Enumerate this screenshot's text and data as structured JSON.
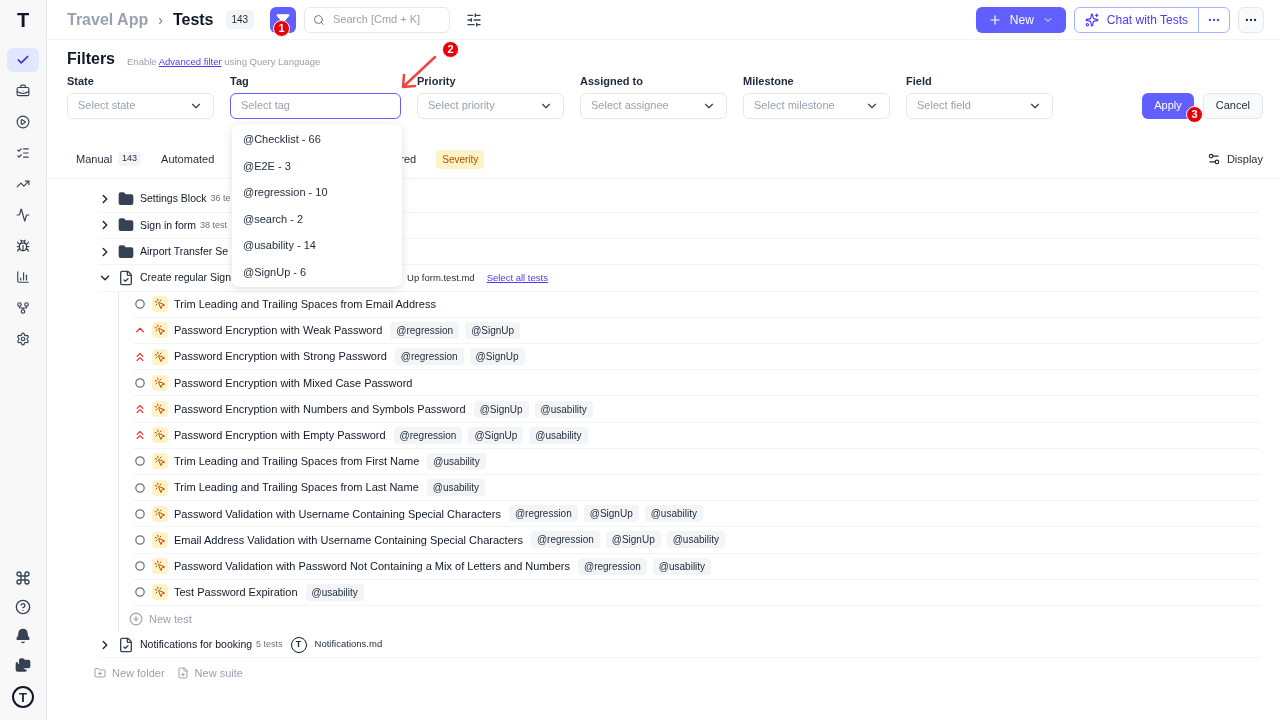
{
  "sidebar": {
    "logo": "T",
    "nav_items": [
      {
        "selected": true
      },
      {
        "selected": false
      },
      {
        "selected": false
      },
      {
        "selected": false
      },
      {
        "selected": false
      },
      {
        "selected": false
      },
      {
        "selected": false
      },
      {
        "selected": false
      },
      {
        "selected": false
      },
      {
        "selected": false
      }
    ],
    "avatar": "T"
  },
  "header": {
    "project": "Travel App",
    "separator": "›",
    "title": "Tests",
    "count": "143",
    "search_placeholder": "Search [Cmd + K]",
    "new_button": "New",
    "chat_button": "Chat with Tests"
  },
  "filters": {
    "title": "Filters",
    "hint_prefix": "Enable",
    "hint_link": "Advanced filter",
    "hint_suffix": "using Query Language",
    "fields": [
      {
        "label": "State",
        "placeholder": "Select state",
        "focused": false
      },
      {
        "label": "Tag",
        "placeholder": "Select tag",
        "focused": true
      },
      {
        "label": "Priority",
        "placeholder": "Select priority",
        "focused": false
      },
      {
        "label": "Assigned to",
        "placeholder": "Select assignee",
        "focused": false
      },
      {
        "label": "Milestone",
        "placeholder": "Select milestone",
        "focused": false
      },
      {
        "label": "Field",
        "placeholder": "Select field",
        "focused": false
      }
    ],
    "apply": "Apply",
    "cancel": "Cancel"
  },
  "tag_dropdown": {
    "options": [
      "@Checklist - 66",
      "@E2E - 3",
      "@regression - 10",
      "@search - 2",
      "@usability - 14",
      "@SignUp - 6"
    ]
  },
  "tabs": [
    {
      "label": "Manual",
      "count": "143"
    },
    {
      "label": "Automated"
    }
  ],
  "tab_fragment": "red",
  "severity": "Severity",
  "display": "Display",
  "tree": [
    {
      "kind": "folder",
      "name": "Settings Block",
      "count": "36 te",
      "expanded": false
    },
    {
      "kind": "folder",
      "name": "Sign in form",
      "count": "38 test",
      "expanded": false
    },
    {
      "kind": "folder",
      "name": "Airport Transfer Se",
      "expanded": false
    },
    {
      "kind": "suite",
      "name": "Create regular Sign",
      "file": "Up form.test.md",
      "link": "Select all tests",
      "expanded": true,
      "tests": [
        {
          "kind": "normal",
          "name": "Trim Leading and Trailing Spaces from Email Address"
        },
        {
          "kind": "high",
          "name": "Password Encryption with Weak Password",
          "tags": [
            "@regression",
            "@SignUp"
          ]
        },
        {
          "kind": "critical",
          "name": "Password Encryption with Strong Password",
          "tags": [
            "@regression",
            "@SignUp"
          ]
        },
        {
          "kind": "normal",
          "name": "Password Encryption with Mixed Case Password"
        },
        {
          "kind": "critical",
          "name": "Password Encryption with Numbers and Symbols Password",
          "tags": [
            "@SignUp",
            "@usability"
          ]
        },
        {
          "kind": "critical",
          "name": "Password Encryption with Empty Password",
          "tags": [
            "@regression",
            "@SignUp",
            "@usability"
          ]
        },
        {
          "kind": "normal",
          "name": "Trim Leading and Trailing Spaces from First Name",
          "tags": [
            "@usability"
          ]
        },
        {
          "kind": "normal",
          "name": "Trim Leading and Trailing Spaces from Last Name",
          "tags": [
            "@usability"
          ]
        },
        {
          "kind": "normal",
          "name": "Password Validation with Username Containing Special Characters",
          "tags": [
            "@regression",
            "@SignUp",
            "@usability"
          ]
        },
        {
          "kind": "normal",
          "name": "Email Address Validation with Username Containing Special Characters",
          "tags": [
            "@regression",
            "@SignUp",
            "@usability"
          ]
        },
        {
          "kind": "normal",
          "name": "Password Validation with Password Not Containing a Mix of Letters and Numbers",
          "tags": [
            "@regression",
            "@usability"
          ]
        },
        {
          "kind": "normal",
          "name": "Test Password Expiration",
          "tags": [
            "@usability"
          ]
        }
      ],
      "new_test": "New test"
    },
    {
      "kind": "suite",
      "name": "Notifications for booking",
      "count": "5 tests",
      "avatar": "T",
      "file": "Notifications.md",
      "expanded": false
    }
  ],
  "new_folder": "New folder",
  "new_suite": "New suite",
  "annotations": [
    "1",
    "2",
    "3"
  ]
}
